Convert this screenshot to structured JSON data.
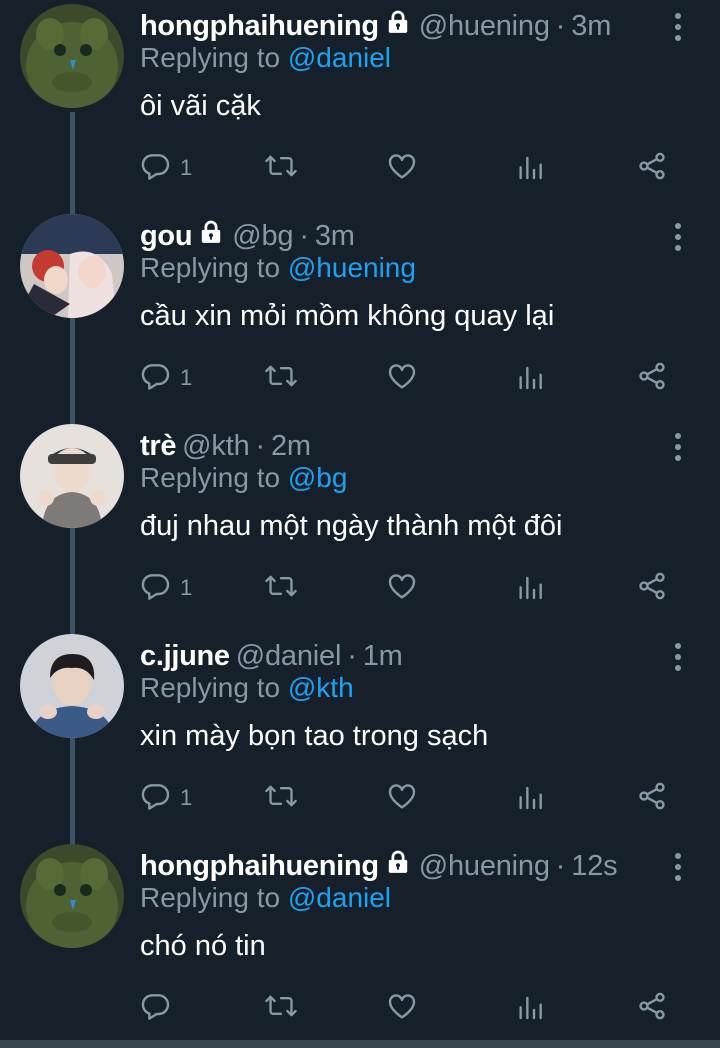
{
  "tweets": [
    {
      "name": "hongphaihuening",
      "locked": true,
      "handle": "@huening",
      "separator": "·",
      "time": "3m",
      "replying_to_label": "Replying to",
      "replying_to": "@daniel",
      "text": "ôi vãi cặk",
      "reply_count": "1",
      "avatar": "green-plush-avatar"
    },
    {
      "name": "gou",
      "locked": true,
      "handle": "@bg",
      "separator": "·",
      "time": "3m",
      "replying_to_label": "Replying to",
      "replying_to": "@huening",
      "text": "cầu xin mỏi mồm không quay lại",
      "reply_count": "1",
      "avatar": "anime-avatar"
    },
    {
      "name": "trè",
      "locked": false,
      "handle": "@kth",
      "separator": "·",
      "time": "2m",
      "replying_to_label": "Replying to",
      "replying_to": "@bg",
      "text": "đuj nhau một ngày thành một đôi",
      "reply_count": "1",
      "avatar": "person-cap-avatar"
    },
    {
      "name": "c.jjune",
      "locked": false,
      "handle": "@daniel",
      "separator": "·",
      "time": "1m",
      "replying_to_label": "Replying to",
      "replying_to": "@kth",
      "text": "xin mày bọn tao trong sạch",
      "reply_count": "1",
      "avatar": "person-avatar"
    },
    {
      "name": "hongphaihuening",
      "locked": true,
      "handle": "@huening",
      "separator": "·",
      "time": "12s",
      "replying_to_label": "Replying to",
      "replying_to": "@daniel",
      "text": "chó nó tin",
      "reply_count": "",
      "avatar": "green-plush-avatar"
    }
  ],
  "icons": {
    "reply": "reply-icon",
    "retweet": "retweet-icon",
    "like": "heart-icon",
    "stats": "analytics-icon",
    "share": "share-icon",
    "more": "more-options-icon",
    "lock": "lock-icon"
  },
  "colors": {
    "background": "#15202b",
    "text": "#ffffff",
    "secondary": "#8899a6",
    "accent": "#1da1f2",
    "thread_line": "#3d5466"
  }
}
